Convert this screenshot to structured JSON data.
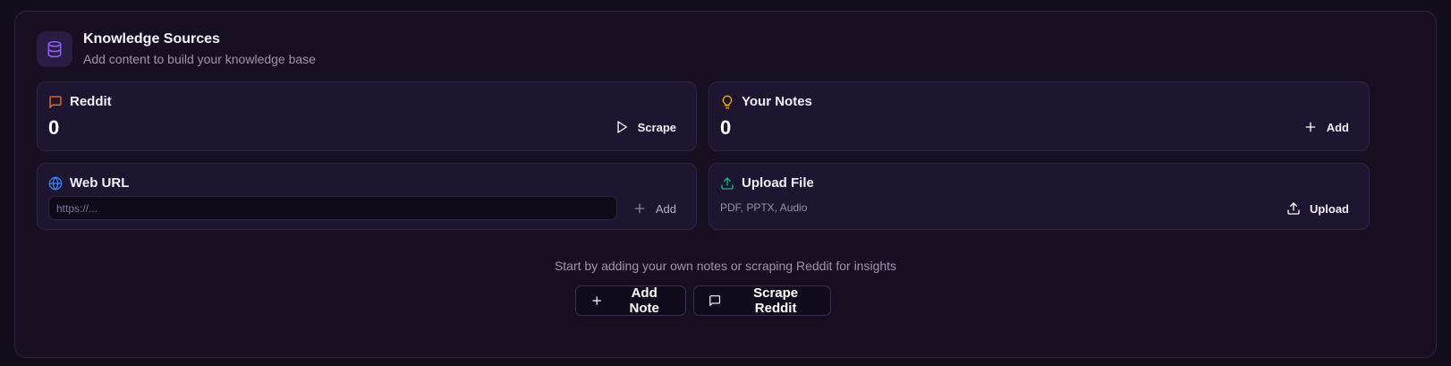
{
  "header": {
    "title": "Knowledge Sources",
    "subtitle": "Add content to build your knowledge base",
    "icon": "database-icon"
  },
  "cards": {
    "reddit": {
      "title": "Reddit",
      "count": "0",
      "action_label": "Scrape",
      "icon": "message-square-icon",
      "accent": "#f97316"
    },
    "notes": {
      "title": "Your Notes",
      "count": "0",
      "action_label": "Add",
      "icon": "lightbulb-icon",
      "accent": "#eab308"
    },
    "web_url": {
      "title": "Web URL",
      "placeholder": "https://...",
      "value": "",
      "action_label": "Add",
      "icon": "globe-icon",
      "accent": "#3b82f6"
    },
    "upload": {
      "title": "Upload File",
      "file_types": "PDF, PPTX, Audio",
      "action_label": "Upload",
      "icon": "upload-icon",
      "accent": "#10b981"
    }
  },
  "empty_state": {
    "hint": "Start by adding your own notes or scraping Reddit for insights",
    "add_note_label": "Add Note",
    "scrape_reddit_label": "Scrape Reddit"
  },
  "colors": {
    "background": "#130e1b",
    "panel": "#180f22",
    "card": "#1e1530",
    "border": "#2e2540",
    "header_accent": "#8b5cf6"
  }
}
